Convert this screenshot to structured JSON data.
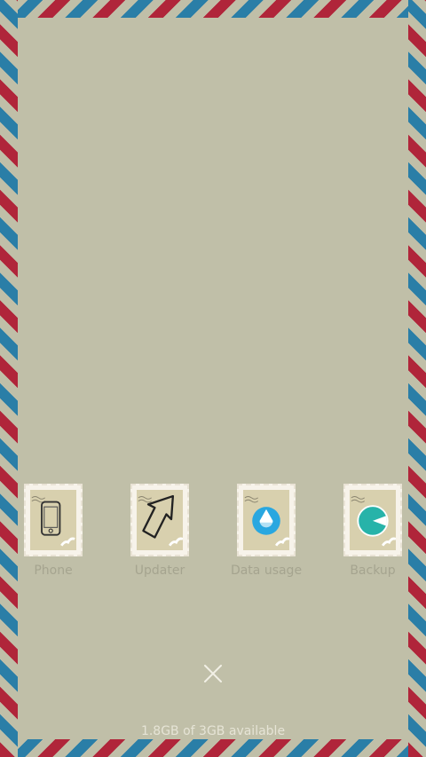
{
  "apps": [
    {
      "label": "Phone",
      "icon": "phone-icon"
    },
    {
      "label": "Updater",
      "icon": "updater-arrow-icon"
    },
    {
      "label": "Data usage",
      "icon": "data-usage-drop-icon"
    },
    {
      "label": "Backup",
      "icon": "backup-icon"
    }
  ],
  "storage": {
    "text": "1.8GB of 3GB available"
  },
  "close": {
    "icon": "close-icon"
  },
  "colors": {
    "background": "#c0bfa8",
    "stripe_red": "#b0253a",
    "stripe_blue": "#2a7ea7",
    "accent_blue": "#29a7e0",
    "accent_teal": "#27b3a9"
  }
}
